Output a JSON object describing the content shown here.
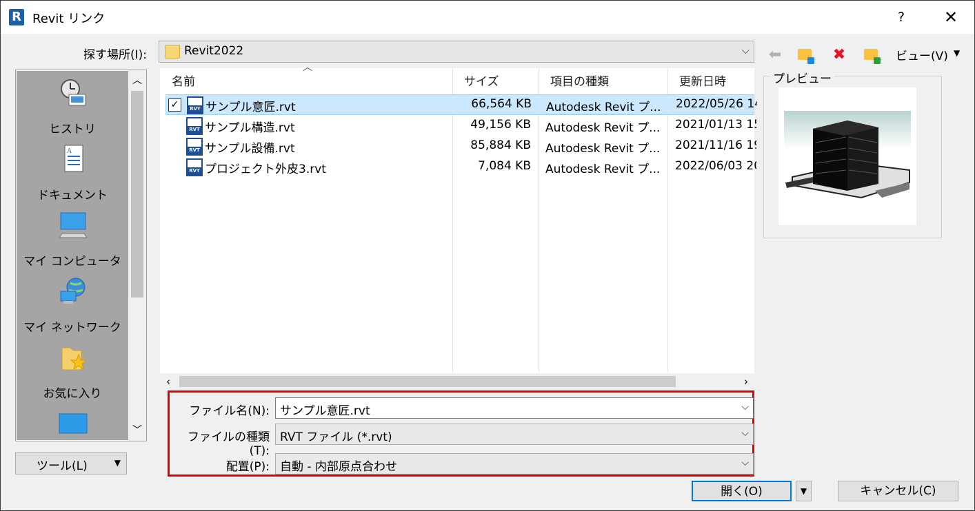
{
  "window": {
    "title": "Revit リンク",
    "app_icon_letter": "R",
    "help": "?",
    "close": "✕"
  },
  "lookin": {
    "label": "探す場所(I):",
    "value": "Revit2022"
  },
  "toolbar": {
    "views_label": "ビュー(V)"
  },
  "places": [
    {
      "label": "ヒストリ"
    },
    {
      "label": "ドキュメント"
    },
    {
      "label": "マイ コンピュータ"
    },
    {
      "label": "マイ ネットワーク"
    },
    {
      "label": "お気に入り"
    }
  ],
  "tools": {
    "label": "ツール(L)"
  },
  "columns": {
    "name": "名前",
    "size": "サイズ",
    "type": "項目の種類",
    "date": "更新日時"
  },
  "files": [
    {
      "name": "サンプル意匠.rvt",
      "size": "66,564 KB",
      "type": "Autodesk Revit プ...",
      "date": "2022/05/26 14",
      "selected": true
    },
    {
      "name": "サンプル構造.rvt",
      "size": "49,156 KB",
      "type": "Autodesk Revit プ...",
      "date": "2021/01/13 15",
      "selected": false
    },
    {
      "name": "サンプル設備.rvt",
      "size": "85,884 KB",
      "type": "Autodesk Revit プ...",
      "date": "2021/11/16 19",
      "selected": false
    },
    {
      "name": "プロジェクト外皮3.rvt",
      "size": "7,084 KB",
      "type": "Autodesk Revit プ...",
      "date": "2022/06/03 20",
      "selected": false
    }
  ],
  "rvt_icon_text": "RVT",
  "preview": {
    "label": "プレビュー"
  },
  "filename": {
    "label": "ファイル名(N):",
    "value": "サンプル意匠.rvt"
  },
  "filetype": {
    "label": "ファイルの種類(T):",
    "value": "RVT ファイル (*.rvt)"
  },
  "positioning": {
    "label": "配置(P):",
    "value": "自動 - 内部原点合わせ"
  },
  "buttons": {
    "open": "開く(O)",
    "cancel": "キャンセル(C)"
  },
  "colors": {
    "selection": "#cce8ff",
    "highlight_border": "#e00000",
    "rvt_blue": "#1f4e96"
  }
}
